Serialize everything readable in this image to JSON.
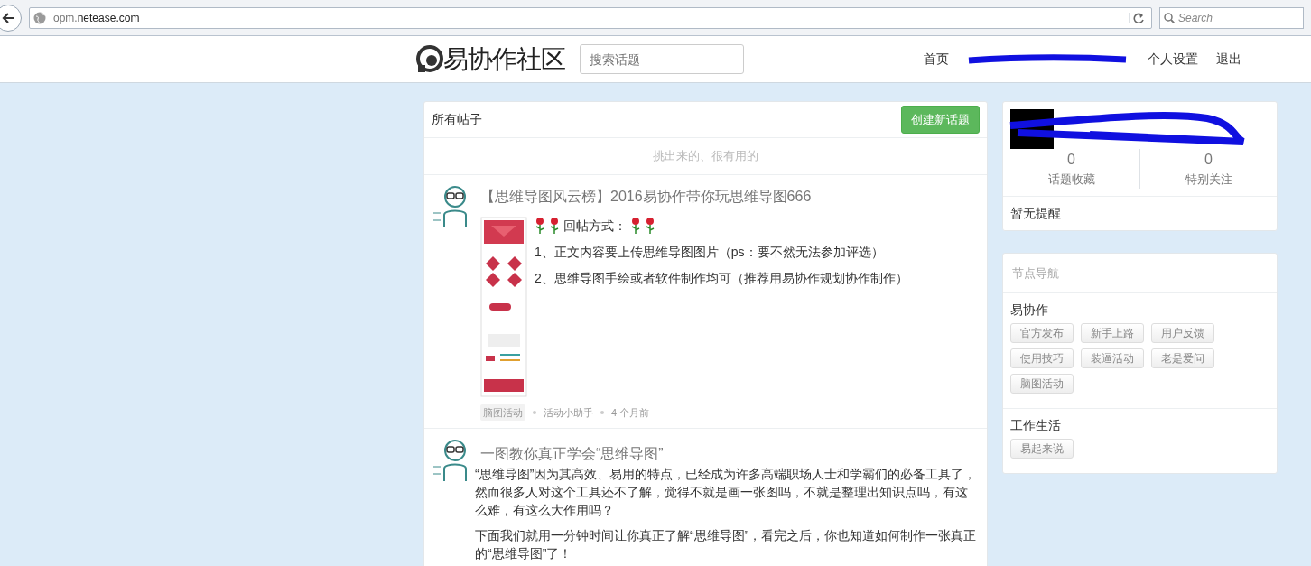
{
  "browser": {
    "url": "opm.**netease.com**",
    "search_placeholder": "Search"
  },
  "header": {
    "logo_text": "易协作社区",
    "search_placeholder": "搜索话题",
    "nav": [
      {
        "kind": "link",
        "label": "首页"
      },
      {
        "kind": "redacted"
      },
      {
        "kind": "link",
        "label": "个人设置"
      },
      {
        "kind": "link",
        "label": "退出"
      }
    ]
  },
  "main": {
    "title": "所有帖子",
    "new_button": "创建新话题",
    "subtitle": "挑出来的、很有用的",
    "posts": [
      {
        "kind": "image",
        "title": "【思维导图风云榜】2016易协作带你玩思维导图666",
        "heading": "回帖方式：",
        "lines": [
          "1、正文内容要上传思维导图图片（ps：要不然无法参加评选）",
          "2、思维导图手绘或者软件制作均可（推荐用易协作规划协作制作）"
        ],
        "tag": "脑图活动",
        "author": "活动小助手",
        "time": "4 个月前"
      },
      {
        "kind": "text",
        "title": "一图教你真正学会“思维导图”",
        "paragraphs": [
          "“思维导图”因为其高效、易用的特点，已经成为许多高端职场人士和学霸们的必备工具了，然而很多人对这个工具还不了解，觉得不就是画一张图吗，不就是整理出知识点吗，有这么难，有这么大作用吗？",
          "下面我们就用一分钟时间让你真正了解“思维导图”，看完之后，你也知道如何制作一张真正的“思维导图”了！"
        ]
      }
    ]
  },
  "sidebar": {
    "stats": [
      {
        "value": "0",
        "label": "话题收藏"
      },
      {
        "value": "0",
        "label": "特别关注"
      }
    ],
    "notice": "暂无提醒",
    "nav_title": "节点导航",
    "groups": [
      {
        "name": "易协作",
        "tags": [
          "官方发布",
          "新手上路",
          "用户反馈",
          "使用技巧",
          "装逼活动",
          "老是爱问",
          "脑图活动"
        ]
      },
      {
        "name": "工作生活",
        "tags": [
          "易起来说"
        ]
      }
    ]
  }
}
